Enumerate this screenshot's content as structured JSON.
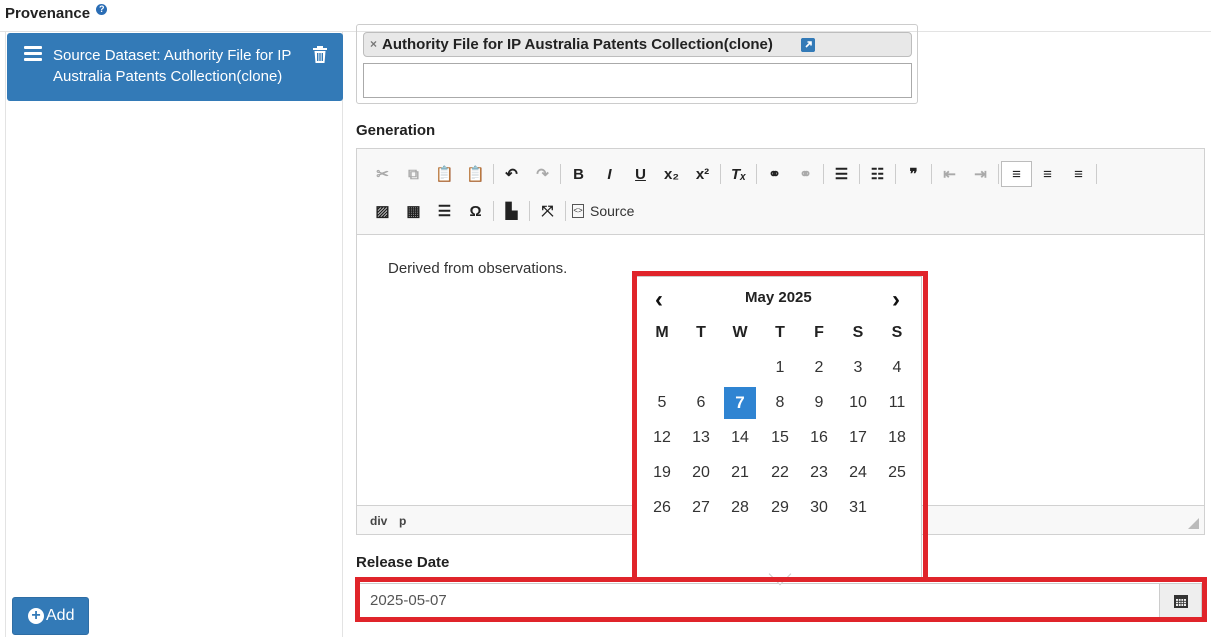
{
  "section": {
    "title": "Provenance",
    "help_icon": "question-circle-icon"
  },
  "left_panel": {
    "dataset_item_label": "Source Dataset: Authority File for IP Australia Patents Collection(clone)",
    "add_label": "Add"
  },
  "source_field": {
    "token_label": "Authority File for IP Australia Patents Collection(clone)",
    "token_remove": "×",
    "input_value": ""
  },
  "generation": {
    "label": "Generation",
    "toolbar_row1": [
      "cut",
      "copy",
      "paste",
      "paste-text",
      "undo",
      "redo",
      "bold",
      "italic",
      "underline",
      "subscript",
      "superscript",
      "remove-format",
      "link",
      "unlink",
      "numbered-list",
      "bulleted-list",
      "blockquote",
      "outdent",
      "indent",
      "align-left",
      "align-center",
      "align-right"
    ],
    "toolbar_row2": [
      "image",
      "table",
      "horizontal-line",
      "special-char",
      "bookmark",
      "maximize",
      "source"
    ],
    "source_label": "Source",
    "body_text": "Derived from observations.",
    "path_crumbs": [
      "div",
      "p"
    ]
  },
  "release_date": {
    "label": "Release Date",
    "value": "2025-05-07"
  },
  "datepicker": {
    "month_label": "May 2025",
    "weekdays": [
      "M",
      "T",
      "W",
      "T",
      "F",
      "S",
      "S"
    ],
    "weeks": [
      [
        "",
        "",
        "",
        "1",
        "2",
        "3",
        "4"
      ],
      [
        "5",
        "6",
        "7",
        "8",
        "9",
        "10",
        "11"
      ],
      [
        "12",
        "13",
        "14",
        "15",
        "16",
        "17",
        "18"
      ],
      [
        "19",
        "20",
        "21",
        "22",
        "23",
        "24",
        "25"
      ],
      [
        "26",
        "27",
        "28",
        "29",
        "30",
        "31",
        ""
      ]
    ],
    "selected_day": "7",
    "selected_color": "#2f84d2"
  },
  "colors": {
    "primary": "#337ab7",
    "highlight": "#e0242a"
  }
}
